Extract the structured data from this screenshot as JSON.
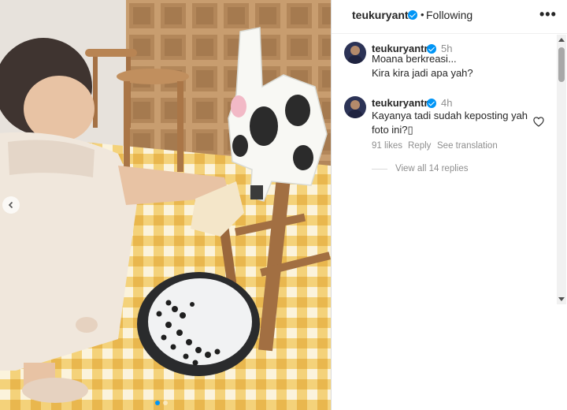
{
  "header": {
    "username": "teukuryantr",
    "separator": "•",
    "follow_status": "Following",
    "more_label": "•••"
  },
  "comments": [
    {
      "username": "teukuryantr",
      "time": "5h",
      "lines": [
        "Moana berkreasi...",
        "Kira kira jadi apa yah?"
      ]
    },
    {
      "username": "teukuryantr",
      "time": "4h",
      "lines": [
        "Kayanya tadi sudah keposting yah",
        "foto ini?▯"
      ],
      "likes": "91 likes",
      "reply_label": "Reply",
      "translate_label": "See translation",
      "view_replies": "View all 14 replies"
    }
  ],
  "carousel": {
    "current": 1,
    "total": 2
  },
  "colors": {
    "accent": "#0095f6",
    "text": "#262626",
    "muted": "#8e8e8e"
  },
  "icons": [
    "verified-badge-icon",
    "more-options-icon",
    "heart-icon",
    "chevron-left-icon"
  ]
}
